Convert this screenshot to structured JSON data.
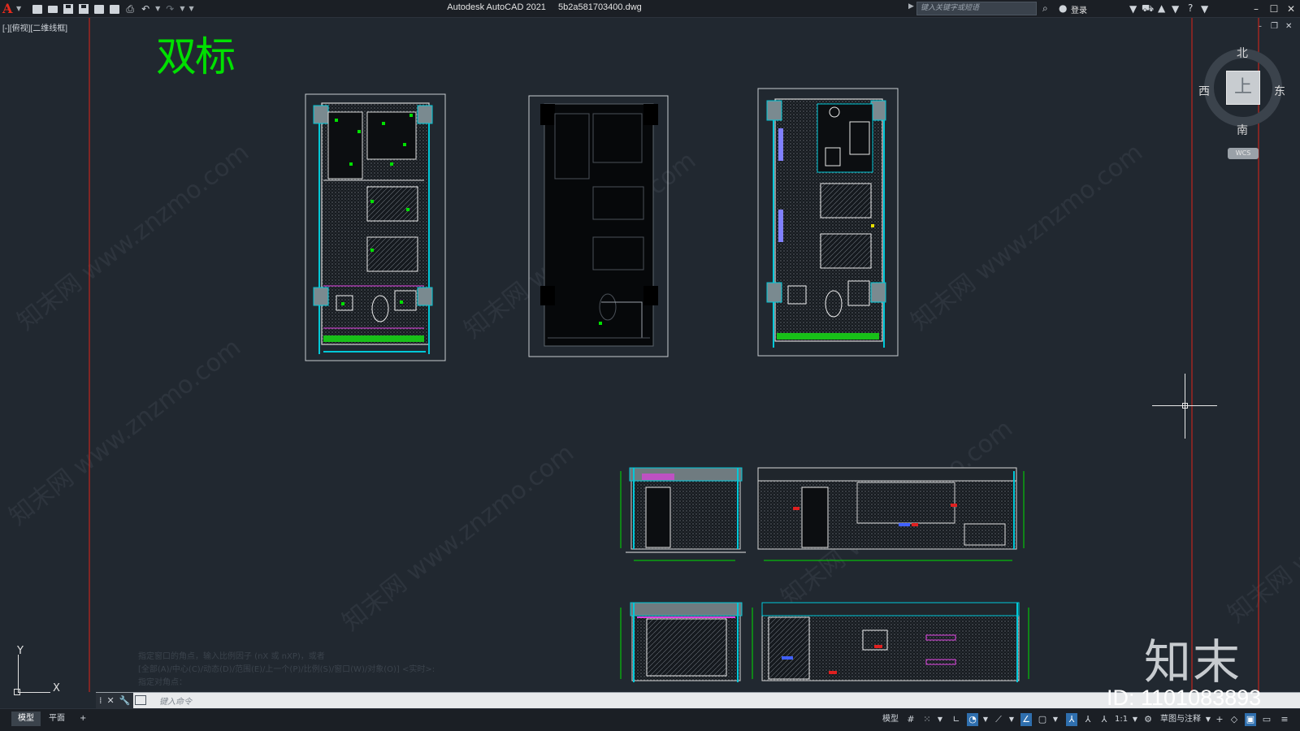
{
  "window": {
    "app_title": "Autodesk AutoCAD 2021",
    "file_name": "5b2a581703400.dwg",
    "search_placeholder": "键入关键字或短语",
    "login_label": "登录"
  },
  "viewport": {
    "label": "[-][俯视][二维线框]"
  },
  "drawing": {
    "title_text": "双标",
    "title_color": "#00e000"
  },
  "viewcube": {
    "north": "北",
    "south": "南",
    "east": "东",
    "west": "西",
    "face": "上",
    "wcs": "WCS"
  },
  "ucs": {
    "x": "X",
    "y": "Y"
  },
  "command": {
    "history": [
      "指定窗口的角点，输入比例因子 (nX 或 nXP)，或者",
      "[全部(A)/中心(C)/动态(D)/范围(E)/上一个(P)/比例(S)/窗口(W)/对象(O)] <实时>:",
      "指定对角点："
    ],
    "placeholder": "键入命令"
  },
  "status": {
    "tabs": [
      "模型",
      "平面",
      "+"
    ],
    "model_label": "模型",
    "scale": "1:1",
    "workspace": "草图与注释"
  },
  "watermark": {
    "site": "知末网 www.znzmo.com",
    "brand": "知末",
    "id": "ID: 1101083893"
  },
  "colors": {
    "background": "#212830",
    "accent_red": "#e32b1e",
    "cad_green": "#00e000",
    "cad_cyan": "#00c8d8",
    "cad_magenta": "#e040e0"
  }
}
